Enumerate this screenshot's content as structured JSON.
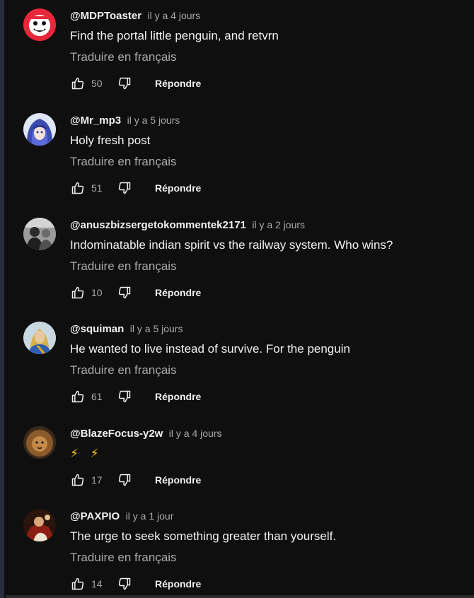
{
  "comments": [
    {
      "author": "@MDPToaster",
      "time": "il y a 4 jours",
      "text": "Find the portal little penguin, and retvrn",
      "translate": "Traduire en français",
      "likes": "50",
      "reply": "Répondre",
      "avatar": "red-cartoon-face-avatar"
    },
    {
      "author": "@Mr_mp3",
      "time": "il y a 5 jours",
      "text": "Holy fresh post",
      "translate": "Traduire en français",
      "likes": "51",
      "reply": "Répondre",
      "avatar": "anime-blue-hair-avatar"
    },
    {
      "author": "@anuszbizsergetokommentek2171",
      "time": "il y a 2 jours",
      "text": "Indominatable indian spirit vs the railway system. Who wins?",
      "translate": "Traduire en français",
      "likes": "10",
      "reply": "Répondre",
      "avatar": "grayscale-photo-avatar"
    },
    {
      "author": "@squiman",
      "time": "il y a 5 jours",
      "text": "He wanted to live instead of survive. For the penguin",
      "translate": "Traduire en français",
      "likes": "61",
      "reply": "Répondre",
      "avatar": "painted-portrait-avatar"
    },
    {
      "author": "@BlazeFocus-y2w",
      "time": "il y a 4 jours",
      "text": "⚡ ⚡",
      "likes": "17",
      "reply": "Répondre",
      "avatar": "lion-avatar"
    },
    {
      "author": "@PAXPIO",
      "time": "il y a 1 jour",
      "text": "The urge to seek something greater than yourself.",
      "translate": "Traduire en français",
      "likes": "14",
      "reply": "Répondre",
      "avatar": "classical-painting-avatar"
    }
  ],
  "icons": {
    "like": "thumbs-up-icon",
    "dislike": "thumbs-down-icon"
  },
  "colors": {
    "background": "#0f0f0f",
    "primary_text": "#f1f1f1",
    "secondary_text": "#aaaaaa"
  }
}
